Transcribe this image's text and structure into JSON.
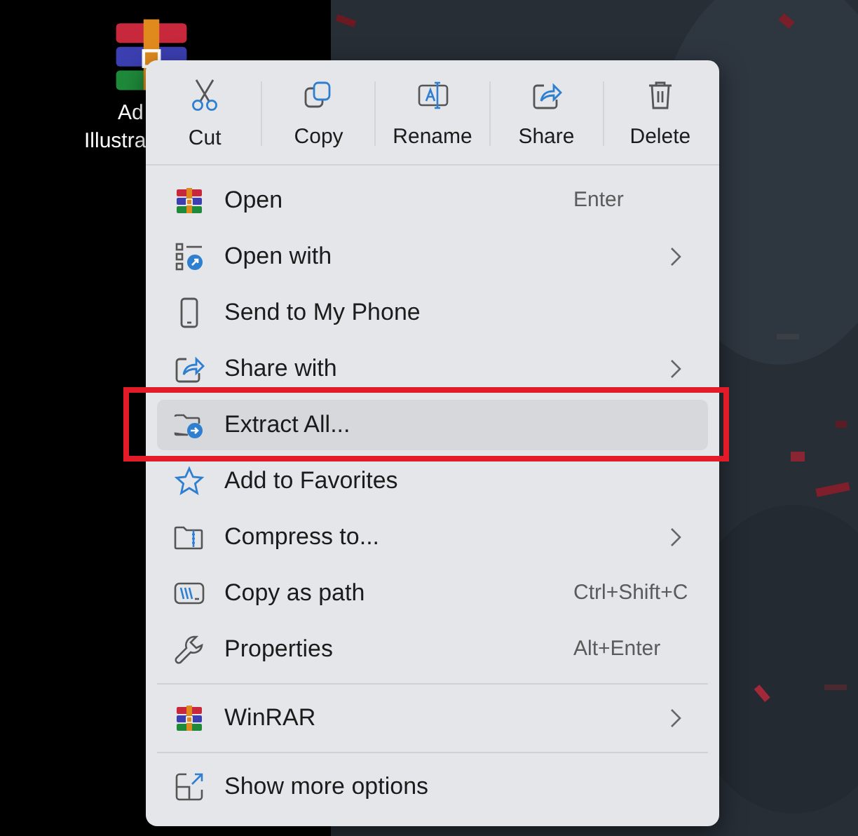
{
  "desktop_icon": {
    "label_lines": [
      "Ad",
      "Illustra"
    ]
  },
  "toolbar": [
    {
      "kind": "cut",
      "label": "Cut"
    },
    {
      "kind": "copy",
      "label": "Copy"
    },
    {
      "kind": "rename",
      "label": "Rename"
    },
    {
      "kind": "share",
      "label": "Share"
    },
    {
      "kind": "delete",
      "label": "Delete"
    }
  ],
  "groups": [
    [
      {
        "kind": "winrar",
        "label": "Open",
        "shortcut": "Enter",
        "submenu": false,
        "selected": false,
        "outlined": false
      },
      {
        "kind": "openwith",
        "label": "Open with",
        "submenu": true,
        "selected": false,
        "outlined": false
      },
      {
        "kind": "phone",
        "label": "Send to My Phone",
        "submenu": false,
        "selected": false,
        "outlined": false
      },
      {
        "kind": "share",
        "label": "Share with",
        "submenu": true,
        "selected": false,
        "outlined": false
      },
      {
        "kind": "extract",
        "label": "Extract All...",
        "submenu": false,
        "selected": true,
        "outlined": true
      },
      {
        "kind": "star",
        "label": "Add to Favorites",
        "submenu": false,
        "selected": false,
        "outlined": false
      },
      {
        "kind": "compress",
        "label": "Compress to...",
        "submenu": true,
        "selected": false,
        "outlined": false
      },
      {
        "kind": "path",
        "label": "Copy as path",
        "shortcut": "Ctrl+Shift+C",
        "submenu": false,
        "selected": false,
        "outlined": false
      },
      {
        "kind": "wrench",
        "label": "Properties",
        "shortcut": "Alt+Enter",
        "submenu": false,
        "selected": false,
        "outlined": false
      }
    ],
    [
      {
        "kind": "winrar",
        "label": "WinRAR",
        "submenu": true,
        "selected": false,
        "outlined": false
      }
    ],
    [
      {
        "kind": "more",
        "label": "Show more options",
        "submenu": false,
        "selected": false,
        "outlined": false
      }
    ]
  ]
}
